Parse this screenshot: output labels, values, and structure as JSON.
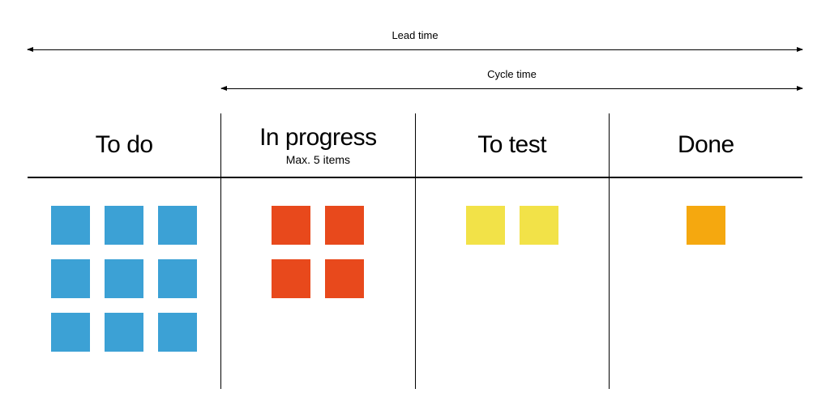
{
  "brackets": {
    "lead": "Lead time",
    "cycle": "Cycle time"
  },
  "columns": [
    {
      "title": "To do",
      "subtitle": "",
      "cards": 9,
      "gridCols": 3,
      "color": "#3CA1D5"
    },
    {
      "title": "In progress",
      "subtitle": "Max. 5 items",
      "cards": 4,
      "gridCols": 2,
      "color": "#E8491C"
    },
    {
      "title": "To test",
      "subtitle": "",
      "cards": 2,
      "gridCols": 2,
      "color": "#F2E248"
    },
    {
      "title": "Done",
      "subtitle": "",
      "cards": 1,
      "gridCols": 1,
      "color": "#F5A80F"
    }
  ]
}
